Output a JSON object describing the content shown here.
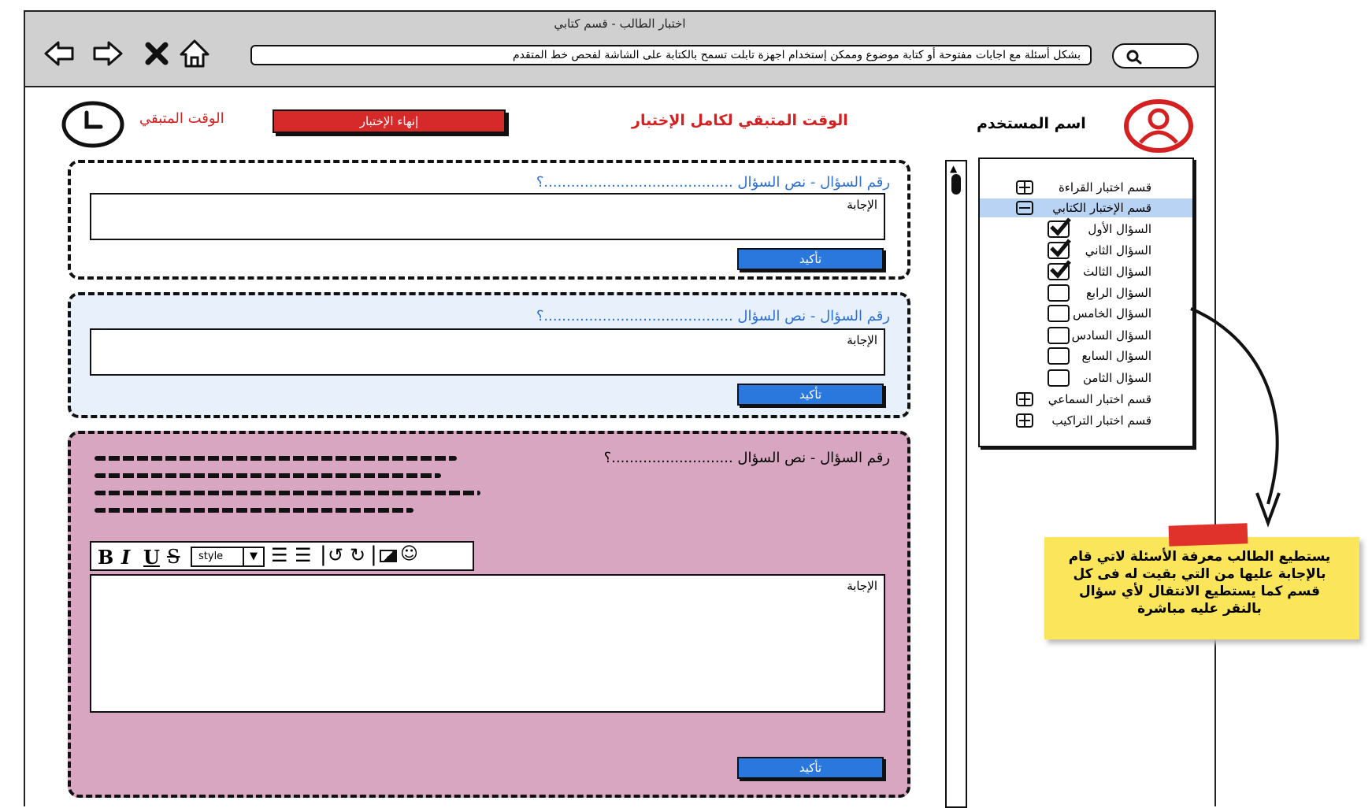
{
  "window": {
    "title": "اختبار الطالب - قسم كتابي"
  },
  "address_bar": {
    "text": "بشكل أسئلة مع اجابات مفتوحة أو كتابة موضوع وممكن إستخدام اجهزة تابلت تسمح بالكتابة على الشاشة لفحص خط المتقدم"
  },
  "header": {
    "timer_label": "الوقت المتبقي",
    "end_exam_label": "إنهاء الإختبار",
    "total_time_label": "الوقت المتبقي لكامل الإختبار",
    "username_label": "اسم المستخدم"
  },
  "questions": [
    {
      "title": "رقم السؤال - نص السؤال ..........................................؟",
      "answer_placeholder": "الإجابة",
      "confirm_label": "تأكيد"
    },
    {
      "title": "رقم السؤال - نص السؤال ..........................................؟",
      "answer_placeholder": "الإجابة",
      "confirm_label": "تأكيد"
    },
    {
      "title": "رقم السؤال - نص السؤال ...........................؟",
      "answer_placeholder": "الإجابة",
      "confirm_label": "تأكيد",
      "editor": {
        "style_label": "style",
        "bold": "B",
        "italic": "I",
        "underline": "U",
        "strike": "S"
      }
    }
  ],
  "sidebar": {
    "items": [
      {
        "label": "قسم اختبار القراءة",
        "type": "plus"
      },
      {
        "label": "قسم الإختبار الكتابي",
        "type": "minus"
      },
      {
        "label": "السؤال الأول",
        "type": "checked"
      },
      {
        "label": "السؤال الثاني",
        "type": "checked"
      },
      {
        "label": "السؤال الثالث",
        "type": "checked"
      },
      {
        "label": "السؤال الرابع",
        "type": "unchecked"
      },
      {
        "label": "السؤال الخامس",
        "type": "unchecked"
      },
      {
        "label": "السؤال السادس",
        "type": "unchecked"
      },
      {
        "label": "السؤال السابع",
        "type": "unchecked"
      },
      {
        "label": "السؤال الثامن",
        "type": "unchecked"
      },
      {
        "label": "قسم اختبار السماعي",
        "type": "plus"
      },
      {
        "label": "قسم اختبار التراكيب",
        "type": "plus"
      }
    ]
  },
  "note": {
    "text": "يستطيع الطالب معرفة الأسئلة لاتي قام بالإجابة عليها من التي بقيت له فى كل قسم كما يستطيع الانتقال لأي سؤال بالنقر عليه مباشرة"
  },
  "colors": {
    "accent_red": "#d42020",
    "accent_blue": "#2a78de",
    "question3_bg": "#d8a6c0",
    "question2_bg": "#e8f1fb",
    "highlight_row": "#b9d3f4",
    "note_bg": "#fbe55a"
  }
}
